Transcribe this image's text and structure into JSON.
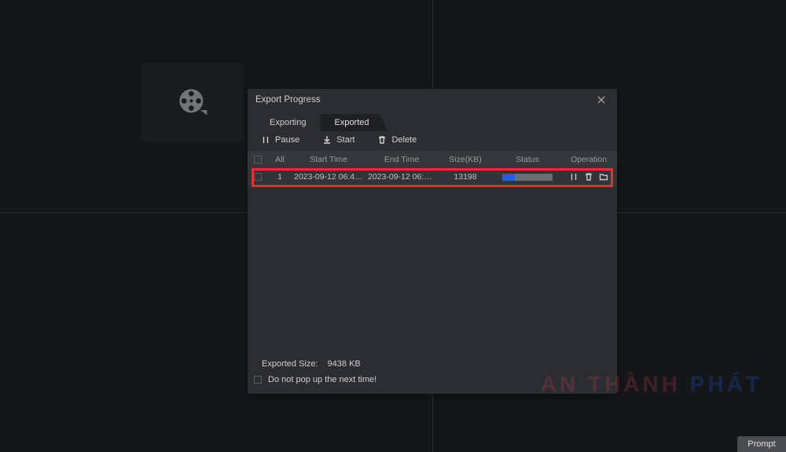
{
  "modal": {
    "title": "Export Progress",
    "tabs": {
      "exporting": "Exporting",
      "exported": "Exported"
    },
    "toolbar": {
      "pause": "Pause",
      "start": "Start",
      "delete": "Delete"
    },
    "table": {
      "headers": {
        "all": "All",
        "start_time": "Start Time",
        "end_time": "End Time",
        "size": "Size(KB)",
        "status": "Status",
        "operation": "Operation"
      },
      "rows": [
        {
          "id": "1",
          "start": "2023-09-12 06:41:...",
          "end": "2023-09-12 06:42:...",
          "size": "13198",
          "progress_pct": 25
        }
      ]
    },
    "footer": {
      "exported_label": "Exported Size:",
      "exported_value": "9438 KB",
      "popup_label": "Do not pop up the next time!"
    }
  },
  "watermark": {
    "part1": "AN THÀNH ",
    "part2": "PHÁT"
  },
  "prompt_label": "Prompt"
}
